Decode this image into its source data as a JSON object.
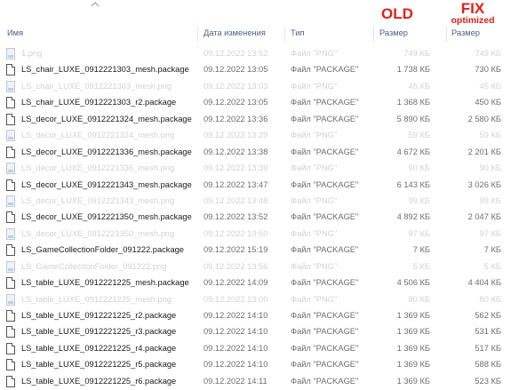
{
  "annotations": {
    "old": "OLD",
    "fix": "FIX",
    "fix_sub": "optimized",
    "color": "#e0201a"
  },
  "columns": {
    "name": "Имя",
    "date": "Дата изменения",
    "type": "Тип",
    "size_old": "Размер",
    "size_fix": "Размер"
  },
  "icons": {
    "sort": "chevron-up-icon",
    "package": "file-icon",
    "png": "image-file-icon"
  },
  "files": [
    {
      "name": "1.png",
      "date": "09.12.2022 13:52",
      "type": "Файл \"PNG\"",
      "size_old": "749 КБ",
      "size_fix": "749 КБ",
      "kind": "png"
    },
    {
      "name": "LS_chair_LUXE_0912221303_mesh.package",
      "date": "09.12.2022 13:05",
      "type": "Файл \"PACKAGE\"",
      "size_old": "1 738 КБ",
      "size_fix": "730 КБ",
      "kind": "package"
    },
    {
      "name": "LS_chair_LUXE_0912221303_mesh.png",
      "date": "09.12.2022 13:03",
      "type": "Файл \"PNG\"",
      "size_old": "45 КБ",
      "size_fix": "45 КБ",
      "kind": "png"
    },
    {
      "name": "LS_chair_LUXE_0912221303_r2.package",
      "date": "09.12.2022 13:05",
      "type": "Файл \"PACKAGE\"",
      "size_old": "1 368 КБ",
      "size_fix": "450 КБ",
      "kind": "package"
    },
    {
      "name": "LS_decor_LUXE_0912221324_mesh.package",
      "date": "09.12.2022 13:36",
      "type": "Файл \"PACKAGE\"",
      "size_old": "5 890 КБ",
      "size_fix": "2 580 КБ",
      "kind": "package"
    },
    {
      "name": "LS_decor_LUXE_0912221324_mesh.png",
      "date": "09.12.2022 13:29",
      "type": "Файл \"PNG\"",
      "size_old": "59 КБ",
      "size_fix": "59 КБ",
      "kind": "png"
    },
    {
      "name": "LS_decor_LUXE_0912221336_mesh.package",
      "date": "09.12.2022 13:38",
      "type": "Файл \"PACKAGE\"",
      "size_old": "4 672 КБ",
      "size_fix": "2 201 КБ",
      "kind": "package"
    },
    {
      "name": "LS_decor_LUXE_0912221336_mesh.png",
      "date": "09.12.2022 13:39",
      "type": "Файл \"PNG\"",
      "size_old": "90 КБ",
      "size_fix": "90 КБ",
      "kind": "png"
    },
    {
      "name": "LS_decor_LUXE_0912221343_mesh.package",
      "date": "09.12.2022 13:47",
      "type": "Файл \"PACKAGE\"",
      "size_old": "6 143 КБ",
      "size_fix": "3 026 КБ",
      "kind": "package"
    },
    {
      "name": "LS_decor_LUXE_0912221343_mesh.png",
      "date": "09.12.2022 13:48",
      "type": "Файл \"PNG\"",
      "size_old": "99 КБ",
      "size_fix": "99 КБ",
      "kind": "png"
    },
    {
      "name": "LS_decor_LUXE_0912221350_mesh.package",
      "date": "09.12.2022 13:52",
      "type": "Файл \"PACKAGE\"",
      "size_old": "4 892 КБ",
      "size_fix": "2 047 КБ",
      "kind": "package"
    },
    {
      "name": "LS_decor_LUXE_0912221350_mesh.png",
      "date": "09.12.2022 13:50",
      "type": "Файл \"PNG\"",
      "size_old": "97 КБ",
      "size_fix": "97 КБ",
      "kind": "png"
    },
    {
      "name": "LS_GameCollectionFolder_091222.package",
      "date": "09.12.2022 15:19",
      "type": "Файл \"PACKAGE\"",
      "size_old": "7 КБ",
      "size_fix": "7 КБ",
      "kind": "package"
    },
    {
      "name": "LS_GameCollectionFolder_091222.png",
      "date": "09.12.2022 13:56",
      "type": "Файл \"PNG\"",
      "size_old": "5 КБ",
      "size_fix": "5 КБ",
      "kind": "png"
    },
    {
      "name": "LS_table_LUXE_0912221225_mesh.package",
      "date": "09.12.2022 14:09",
      "type": "Файл \"PACKAGE\"",
      "size_old": "4 506 КБ",
      "size_fix": "4 404 КБ",
      "kind": "package"
    },
    {
      "name": "LS_table_LUXE_0912221225_mesh.png",
      "date": "09.12.2022 13:00",
      "type": "Файл \"PNG\"",
      "size_old": "80 КБ",
      "size_fix": "80 КБ",
      "kind": "png"
    },
    {
      "name": "LS_table_LUXE_0912221225_r2.package",
      "date": "09.12.2022 14:10",
      "type": "Файл \"PACKAGE\"",
      "size_old": "1 369 КБ",
      "size_fix": "562 КБ",
      "kind": "package"
    },
    {
      "name": "LS_table_LUXE_0912221225_r3.package",
      "date": "09.12.2022 14:10",
      "type": "Файл \"PACKAGE\"",
      "size_old": "1 369 КБ",
      "size_fix": "531 КБ",
      "kind": "package"
    },
    {
      "name": "LS_table_LUXE_0912221225_r4.package",
      "date": "09.12.2022 14:10",
      "type": "Файл \"PACKAGE\"",
      "size_old": "1 369 КБ",
      "size_fix": "517 КБ",
      "kind": "package"
    },
    {
      "name": "LS_table_LUXE_0912221225_r5.package",
      "date": "09.12.2022 14:10",
      "type": "Файл \"PACKAGE\"",
      "size_old": "1 369 КБ",
      "size_fix": "588 КБ",
      "kind": "package"
    },
    {
      "name": "LS_table_LUXE_0912221225_r6.package",
      "date": "09.12.2022 14:11",
      "type": "Файл \"PACKAGE\"",
      "size_old": "1 369 КБ",
      "size_fix": "523 КБ",
      "kind": "package"
    }
  ]
}
